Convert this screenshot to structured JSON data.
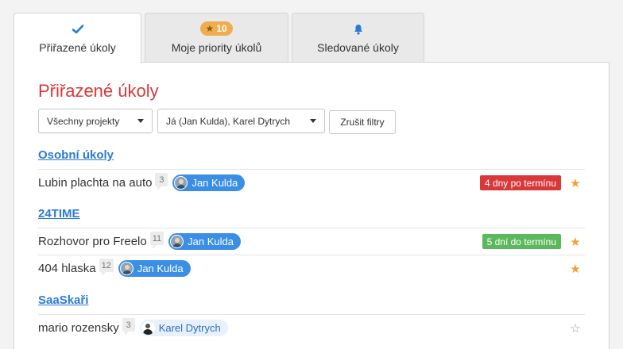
{
  "tabs": [
    {
      "label": "Přiřazené úkoly",
      "icon": "checkmark-icon",
      "active": true
    },
    {
      "label": "Moje priority úkolů",
      "icon": "star-icon",
      "badge": "10"
    },
    {
      "label": "Sledované úkoly",
      "icon": "bell-icon"
    }
  ],
  "page": {
    "title": "Přiřazené úkoly"
  },
  "filters": {
    "project": "Všechny projekty",
    "people": "Já (Jan Kulda), Karel Dytrych",
    "clear": "Zrušit filtry"
  },
  "groups": [
    {
      "title": "Osobní úkoly",
      "tasks": [
        {
          "name": "Lubin plachta na auto",
          "comments": "3",
          "assignee": "Jan Kulda",
          "deadline": "4 dny po termínu",
          "starred": true
        }
      ]
    },
    {
      "title": "24TIME",
      "tasks": [
        {
          "name": "Rozhovor pro Freelo",
          "comments": "11",
          "assignee": "Jan Kulda",
          "deadline": "5 dní do termínu",
          "starred": true
        },
        {
          "name": "404 hlaska",
          "comments": "12",
          "assignee": "Jan Kulda",
          "starred": true
        }
      ]
    },
    {
      "title": "SaaSkaři",
      "tasks": [
        {
          "name": "mario rozensky",
          "comments": "3",
          "assignee": "Karel Dytrych",
          "starred": false
        }
      ]
    }
  ],
  "colors": {
    "accent": "#d9383a",
    "link": "#2a7ad5",
    "overdue": "#d9383a",
    "upcoming": "#5cb85c",
    "star": "#f0a030"
  }
}
